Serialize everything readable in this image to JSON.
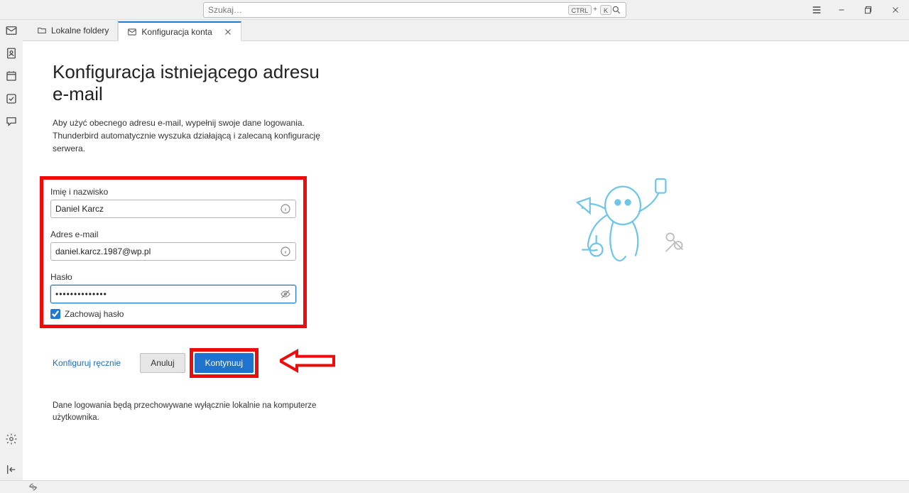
{
  "titlebar": {
    "search_placeholder": "Szukaj…",
    "kbd1": "CTRL",
    "kbd_plus": "+",
    "kbd2": "K"
  },
  "tabs": {
    "local": "Lokalne foldery",
    "config": "Konfiguracja konta"
  },
  "page": {
    "heading": "Konfiguracja istniejącego adresu e-mail",
    "desc1": "Aby użyć obecnego adresu e-mail, wypełnij swoje dane logowania.",
    "desc2": "Thunderbird automatycznie wyszuka działającą i zalecaną konfigurację serwera."
  },
  "form": {
    "name_label": "Imię i nazwisko",
    "name_value": "Daniel Karcz",
    "email_label": "Adres e-mail",
    "email_value": "daniel.karcz.1987@wp.pl",
    "password_label": "Hasło",
    "password_value": "••••••••••••••",
    "remember_label": "Zachowaj hasło"
  },
  "actions": {
    "manual": "Konfiguruj ręcznie",
    "cancel": "Anuluj",
    "continue": "Kontynuuj"
  },
  "footnote": "Dane logowania będą przechowywane wyłącznie lokalnie na komputerze użytkownika."
}
